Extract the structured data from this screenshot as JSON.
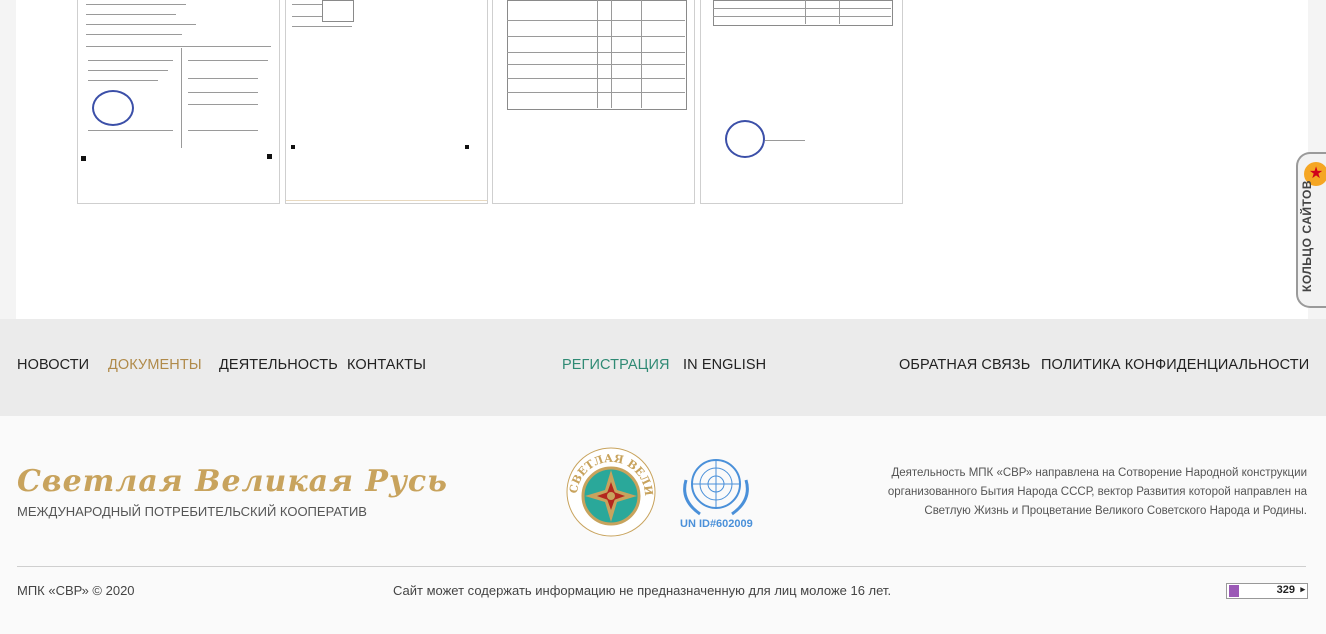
{
  "colors": {
    "accent_gold": "#b08a4a",
    "accent_green": "#2f8a74",
    "brand_gold": "#c8a35d",
    "un_blue": "#4a90d9"
  },
  "nav": {
    "left": [
      "НОВОСТИ",
      "ДОКУМЕНТЫ",
      "ДЕЯТЕЛЬНОСТЬ",
      "КОНТАКТЫ"
    ],
    "active": "ДОКУМЕНТЫ",
    "center": [
      "РЕГИСТРАЦИЯ",
      "IN ENGLISH"
    ],
    "right": [
      "ОБРАТНАЯ СВЯЗЬ",
      "ПОЛИТИКА КОНФИДЕНЦИАЛЬНОСТИ"
    ]
  },
  "footer": {
    "brand_title": "Светлая Великая Русь",
    "brand_subtitle": "МЕЖДУНАРОДНЫЙ ПОТРЕБИТЕЛЬСКИЙ КООПЕРАТИВ",
    "emblem_text": "СВЕТЛАЯ ВЕЛИКАЯ РУСЬ",
    "un_id": "UN ID#602009",
    "description": "Деятельность МПК «СВР» направлена на Сотворение Народной конструкции организованного Бытия Народа СССР, вектор Развития которой направлен на Светлую Жизнь и Процветание Великого Советского Народа и Родины.",
    "copyright": "МПК «СВР» © 2020",
    "age_warning": "Сайт может содержать информацию не предназначенную для лиц моложе 16 лет.",
    "counter_value": "329"
  },
  "widget": {
    "ring_label": "КОЛЬЦО САЙТОВ",
    "icon": "star-icon"
  },
  "documents": {
    "thumbnails": [
      "document-scan-1",
      "document-scan-2",
      "document-scan-3",
      "document-scan-4"
    ]
  }
}
